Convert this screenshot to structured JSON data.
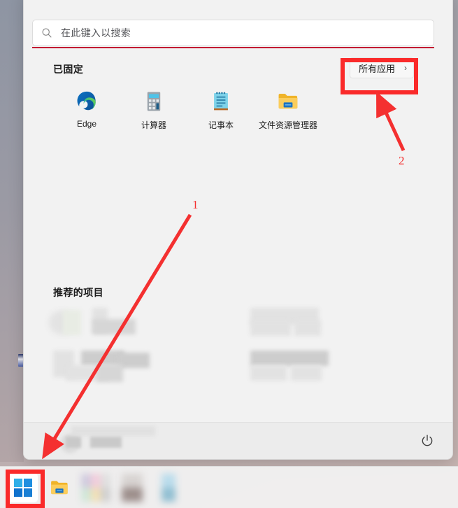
{
  "window": {
    "title": "Windows 11 Start Menu",
    "panel_bg": "#f2f2f2"
  },
  "search": {
    "placeholder": "在此键入以搜索",
    "value": "",
    "icon": "search-icon",
    "underline_color": "#c31432"
  },
  "pinned": {
    "title": "已固定",
    "all_apps": {
      "label": "所有应用",
      "chevron": "›"
    },
    "apps": [
      {
        "label": "Edge",
        "icon": "edge-icon"
      },
      {
        "label": "计算器",
        "icon": "calculator-icon"
      },
      {
        "label": "记事本",
        "icon": "notepad-icon"
      },
      {
        "label": "文件资源管理器",
        "icon": "file-explorer-icon"
      }
    ]
  },
  "recommended": {
    "title": "推荐的项目",
    "items_redacted": true
  },
  "bottom_bar": {
    "account_redacted": true,
    "power_button": {
      "icon": "power-icon",
      "label": ""
    }
  },
  "taskbar": {
    "items": [
      {
        "name": "start-button",
        "icon": "windows-logo-icon",
        "highlighted": true
      },
      {
        "name": "file-explorer-button",
        "icon": "file-explorer-icon",
        "highlighted": false
      },
      {
        "name": "taskbar-app-3",
        "icon": "blurred-app-icon",
        "highlighted": false
      },
      {
        "name": "taskbar-app-4",
        "icon": "blurred-app-icon",
        "highlighted": false
      },
      {
        "name": "taskbar-app-5",
        "icon": "blurred-app-icon",
        "highlighted": false
      }
    ]
  },
  "annotations": {
    "color": "#fa2a2a",
    "steps": [
      {
        "number": "1",
        "target": "start-button",
        "shape": "arrow+rect"
      },
      {
        "number": "2",
        "target": "all-apps-button",
        "shape": "arrow+rect"
      }
    ]
  }
}
